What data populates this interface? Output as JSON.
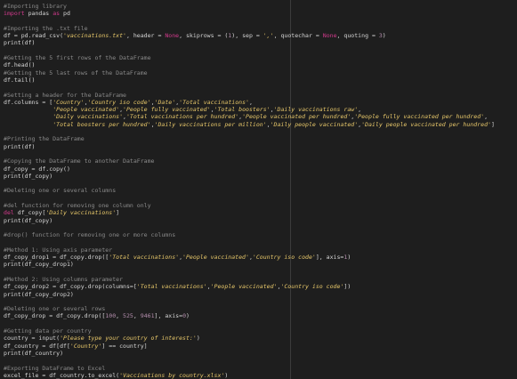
{
  "editor": {
    "lines": [
      [
        {
          "t": "comment",
          "v": "#Importing library"
        }
      ],
      [
        {
          "t": "keyword",
          "v": "import"
        },
        {
          "t": "plain",
          "v": " pandas "
        },
        {
          "t": "keyword",
          "v": "as"
        },
        {
          "t": "plain",
          "v": " pd"
        }
      ],
      [],
      [
        {
          "t": "comment",
          "v": "#Importing the .txt file"
        }
      ],
      [
        {
          "t": "plain",
          "v": "df = pd.read_csv("
        },
        {
          "t": "string",
          "v": "'vaccinations.txt'"
        },
        {
          "t": "plain",
          "v": ", header = "
        },
        {
          "t": "keyword",
          "v": "None"
        },
        {
          "t": "plain",
          "v": ", skiprows = ("
        },
        {
          "t": "number",
          "v": "1"
        },
        {
          "t": "plain",
          "v": "), sep = "
        },
        {
          "t": "string",
          "v": "','"
        },
        {
          "t": "plain",
          "v": ", quotechar = "
        },
        {
          "t": "keyword",
          "v": "None"
        },
        {
          "t": "plain",
          "v": ", quoting = "
        },
        {
          "t": "number",
          "v": "3"
        },
        {
          "t": "plain",
          "v": ")"
        }
      ],
      [
        {
          "t": "plain",
          "v": "print(df)"
        }
      ],
      [],
      [
        {
          "t": "comment",
          "v": "#Getting the 5 first rows of the DataFrame"
        }
      ],
      [
        {
          "t": "plain",
          "v": "df.head()"
        }
      ],
      [
        {
          "t": "comment",
          "v": "#Getting the 5 last rows of the DataFrame"
        }
      ],
      [
        {
          "t": "plain",
          "v": "df.tail()"
        }
      ],
      [],
      [
        {
          "t": "comment",
          "v": "#Setting a header for the DataFrame"
        }
      ],
      [
        {
          "t": "plain",
          "v": "df.columns = ["
        },
        {
          "t": "string",
          "v": "'Country'"
        },
        {
          "t": "plain",
          "v": ","
        },
        {
          "t": "string",
          "v": "'Country iso code'"
        },
        {
          "t": "plain",
          "v": ","
        },
        {
          "t": "string",
          "v": "'Date'"
        },
        {
          "t": "plain",
          "v": ","
        },
        {
          "t": "string",
          "v": "'Total vaccinations'"
        },
        {
          "t": "plain",
          "v": ","
        }
      ],
      [
        {
          "t": "plain",
          "v": "              "
        },
        {
          "t": "string",
          "v": "'People vaccinated'"
        },
        {
          "t": "plain",
          "v": ","
        },
        {
          "t": "string",
          "v": "'People fully vaccinated'"
        },
        {
          "t": "plain",
          "v": ","
        },
        {
          "t": "string",
          "v": "'Total boosters'"
        },
        {
          "t": "plain",
          "v": ","
        },
        {
          "t": "string",
          "v": "'Daily vaccinations raw'"
        },
        {
          "t": "plain",
          "v": ","
        }
      ],
      [
        {
          "t": "plain",
          "v": "              "
        },
        {
          "t": "string",
          "v": "'Daily vaccinations'"
        },
        {
          "t": "plain",
          "v": ","
        },
        {
          "t": "string",
          "v": "'Total vaccinations per hundred'"
        },
        {
          "t": "plain",
          "v": ","
        },
        {
          "t": "string",
          "v": "'People vaccinated per hundred'"
        },
        {
          "t": "plain",
          "v": ","
        },
        {
          "t": "string",
          "v": "'People fully vaccinated per hundred'"
        },
        {
          "t": "plain",
          "v": ","
        }
      ],
      [
        {
          "t": "plain",
          "v": "              "
        },
        {
          "t": "string",
          "v": "'Total boosters per hundred'"
        },
        {
          "t": "plain",
          "v": ","
        },
        {
          "t": "string",
          "v": "'Daily vaccinations per million'"
        },
        {
          "t": "plain",
          "v": ","
        },
        {
          "t": "string",
          "v": "'Daily people vaccinated'"
        },
        {
          "t": "plain",
          "v": ","
        },
        {
          "t": "string",
          "v": "'Daily people vaccinated per hundred'"
        },
        {
          "t": "plain",
          "v": "]"
        }
      ],
      [],
      [
        {
          "t": "comment",
          "v": "#Printing the DataFrame"
        }
      ],
      [
        {
          "t": "plain",
          "v": "print(df)"
        }
      ],
      [],
      [
        {
          "t": "comment",
          "v": "#Copying the DataFrame to another DataFrame"
        }
      ],
      [
        {
          "t": "plain",
          "v": "df_copy = df.copy()"
        }
      ],
      [
        {
          "t": "plain",
          "v": "print(df_copy)"
        }
      ],
      [],
      [
        {
          "t": "comment",
          "v": "#Deleting one or several columns"
        }
      ],
      [],
      [
        {
          "t": "comment",
          "v": "#del function for removing one column only"
        }
      ],
      [
        {
          "t": "keyword",
          "v": "del"
        },
        {
          "t": "plain",
          "v": " df_copy["
        },
        {
          "t": "string",
          "v": "'Daily vaccinations'"
        },
        {
          "t": "plain",
          "v": "]"
        }
      ],
      [
        {
          "t": "plain",
          "v": "print(df_copy)"
        }
      ],
      [],
      [
        {
          "t": "comment",
          "v": "#drop() function for removing one or more columns"
        }
      ],
      [],
      [
        {
          "t": "comment",
          "v": "#Method 1: Using axis parameter"
        }
      ],
      [
        {
          "t": "plain",
          "v": "df_copy_drop1 = df_copy.drop(["
        },
        {
          "t": "string",
          "v": "'Total vaccinations'"
        },
        {
          "t": "plain",
          "v": ","
        },
        {
          "t": "string",
          "v": "'People vaccinated'"
        },
        {
          "t": "plain",
          "v": ","
        },
        {
          "t": "string",
          "v": "'Country iso code'"
        },
        {
          "t": "plain",
          "v": "], axis="
        },
        {
          "t": "number",
          "v": "1"
        },
        {
          "t": "plain",
          "v": ")"
        }
      ],
      [
        {
          "t": "plain",
          "v": "print(df_copy_drop1)"
        }
      ],
      [],
      [
        {
          "t": "comment",
          "v": "#Method 2: Using columns parameter"
        }
      ],
      [
        {
          "t": "plain",
          "v": "df_copy_drop2 = df_copy.drop(columns=["
        },
        {
          "t": "string",
          "v": "'Total vaccinations'"
        },
        {
          "t": "plain",
          "v": ","
        },
        {
          "t": "string",
          "v": "'People vaccinated'"
        },
        {
          "t": "plain",
          "v": ","
        },
        {
          "t": "string",
          "v": "'Country iso code'"
        },
        {
          "t": "plain",
          "v": "])"
        }
      ],
      [
        {
          "t": "plain",
          "v": "print(df_copy_drop2)"
        }
      ],
      [],
      [
        {
          "t": "comment",
          "v": "#Deleting one or several rows"
        }
      ],
      [
        {
          "t": "plain",
          "v": "df_copy_drop = df_copy.drop(["
        },
        {
          "t": "number",
          "v": "100"
        },
        {
          "t": "plain",
          "v": ", "
        },
        {
          "t": "number",
          "v": "525"
        },
        {
          "t": "plain",
          "v": ", "
        },
        {
          "t": "number",
          "v": "9461"
        },
        {
          "t": "plain",
          "v": "], axis="
        },
        {
          "t": "number",
          "v": "0"
        },
        {
          "t": "plain",
          "v": ")"
        }
      ],
      [],
      [
        {
          "t": "comment",
          "v": "#Getting data per country"
        }
      ],
      [
        {
          "t": "plain",
          "v": "country = input("
        },
        {
          "t": "string",
          "v": "'Please type your country of interest:'"
        },
        {
          "t": "plain",
          "v": ")"
        }
      ],
      [
        {
          "t": "plain",
          "v": "df_country = df[df["
        },
        {
          "t": "string",
          "v": "'Country'"
        },
        {
          "t": "plain",
          "v": "] == country]"
        }
      ],
      [
        {
          "t": "plain",
          "v": "print(df_country)"
        }
      ],
      [],
      [
        {
          "t": "comment",
          "v": "#Exporting DataFrame to Excel"
        }
      ],
      [
        {
          "t": "plain",
          "v": "excel_file = df_country.to_excel("
        },
        {
          "t": "string",
          "v": "'Vaccinations by country.xlsx'"
        },
        {
          "t": "plain",
          "v": ")"
        }
      ]
    ]
  },
  "colors": {
    "background": "#1e1e1e",
    "text": "#d4d4d4",
    "comment": "#8a8a8a",
    "keyword": "#d23a8c",
    "string": "#e8c86a",
    "number": "#b48ead"
  }
}
